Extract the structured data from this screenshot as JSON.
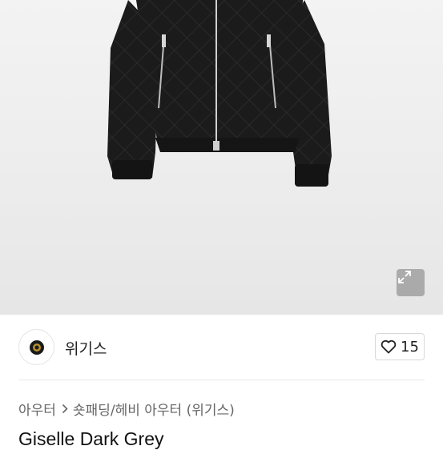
{
  "hero": {
    "image_icon": "jacket-photo",
    "expand_icon": "expand-icon"
  },
  "seller": {
    "name": "위기스",
    "avatar_icon": "brand-logo-icon"
  },
  "like": {
    "icon": "heart-icon",
    "count": "15"
  },
  "breadcrumb": {
    "items": [
      "아우터",
      "숏패딩/헤비 아우터 (위기스)"
    ],
    "separator_icon": "chevron-right-icon"
  },
  "product": {
    "title": "Giselle Dark Grey"
  }
}
